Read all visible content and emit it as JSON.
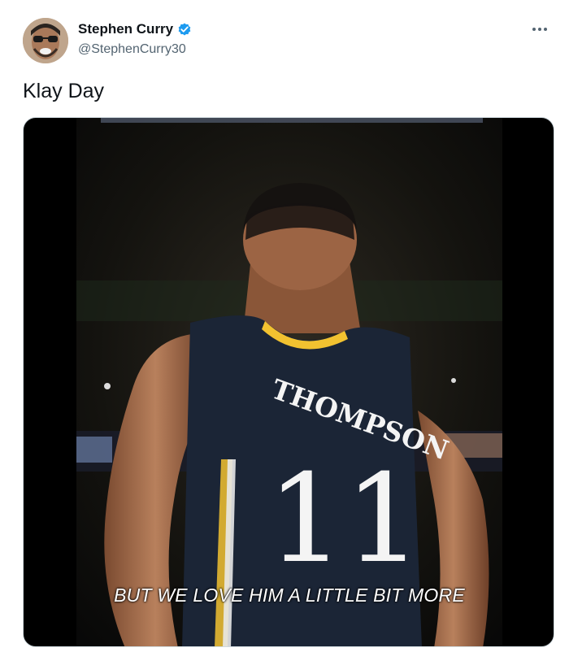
{
  "author": {
    "display_name": "Stephen Curry",
    "handle": "@StephenCurry30",
    "verified": true,
    "avatar_icon": "avatar-photo-icon"
  },
  "tweet": {
    "text": "Klay Day"
  },
  "media": {
    "type": "video",
    "jersey_name": "THOMPSON",
    "jersey_number": "11",
    "caption": "BUT WE LOVE HIM A LITTLE BIT MORE"
  },
  "colors": {
    "verified_blue": "#1d9bf0",
    "text_primary": "#0f1419",
    "text_secondary": "#536471",
    "jersey_navy": "#1b2536",
    "jersey_gold": "#f2c230"
  }
}
